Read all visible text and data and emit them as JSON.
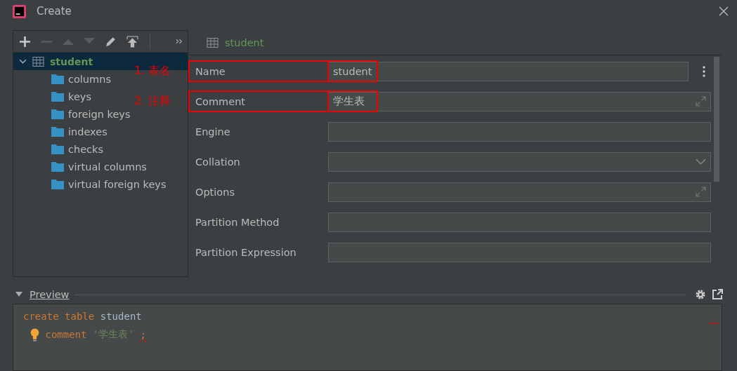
{
  "window": {
    "title": "Create"
  },
  "tree": {
    "label": "student",
    "expanded": true,
    "selected": true,
    "children": [
      {
        "label": "columns"
      },
      {
        "label": "keys"
      },
      {
        "label": "foreign keys"
      },
      {
        "label": "indexes"
      },
      {
        "label": "checks"
      },
      {
        "label": "virtual columns"
      },
      {
        "label": "virtual foreign keys"
      }
    ]
  },
  "panel": {
    "title": "student"
  },
  "fields": [
    {
      "label": "Name",
      "kind": "text",
      "value": "student",
      "annotation": "1. 表名"
    },
    {
      "label": "Comment",
      "kind": "expand",
      "value": "学生表",
      "annotation": "2. 注释"
    },
    {
      "label": "Engine",
      "kind": "text"
    },
    {
      "label": "Collation",
      "kind": "dropdown"
    },
    {
      "label": "Options",
      "kind": "expand"
    },
    {
      "label": "Partition Method",
      "kind": "text"
    },
    {
      "label": "Partition Expression",
      "kind": "text"
    }
  ],
  "preview": {
    "title": "Preview",
    "expanded": true,
    "lines": [
      [
        {
          "kind": "keyword",
          "text": "create"
        },
        {
          "kind": "keyword",
          "text": "table"
        },
        {
          "kind": "ident",
          "text": "student"
        }
      ],
      [
        {
          "kind": "keyword",
          "text": "comment"
        },
        {
          "kind": "string",
          "text": "'学生表'"
        },
        {
          "kind": "error",
          "text": ";"
        }
      ]
    ]
  }
}
